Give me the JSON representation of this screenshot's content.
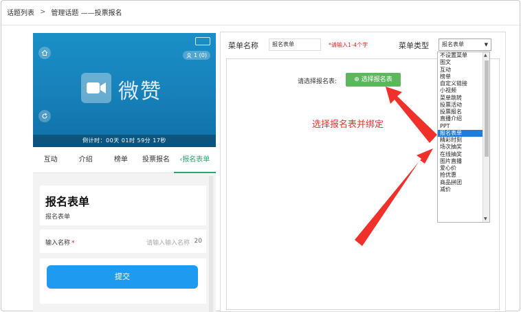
{
  "breadcrumb": {
    "root": "话题列表",
    "sep": ">",
    "current": "管理话题",
    "suffix": "——投票报名"
  },
  "phone": {
    "tag": "",
    "counter": "1 (0)",
    "logo_text": "微赞",
    "countdown": "倒计时：00天 01时 59分 17秒",
    "tabs": [
      {
        "label": "互动"
      },
      {
        "label": "介绍"
      },
      {
        "label": "榜单"
      },
      {
        "label": "投票报名"
      },
      {
        "label": "报名表单"
      }
    ],
    "form_title": "报名表单",
    "form_subtitle": "报名表单",
    "field_label": "输入名称",
    "field_required": "*",
    "field_placeholder": "请输入输入名称",
    "field_counter": "20",
    "submit_label": "提交"
  },
  "panel": {
    "menu_name_label": "菜单名称",
    "menu_name_value": "报名表单",
    "menu_name_hint": "*请输入1-4个字",
    "menu_type_label": "菜单类型",
    "menu_type_value": "报名表单",
    "choose_label": "请选择报名表:",
    "choose_button": "选择报名表",
    "annotation": "选择报名表并绑定"
  },
  "dropdown": {
    "options": [
      "不设置菜单",
      "图文",
      "互动",
      "榜单",
      "自定义链接",
      "小视频",
      "菜单跳转",
      "投票活动",
      "投票报名",
      "直播介绍",
      "PPT",
      "报名表单",
      "精彩时刻",
      "场次抽奖",
      "在线抽奖",
      "图片直播",
      "爱心价",
      "抢优惠",
      "商品拼团",
      "减价"
    ],
    "selected_index": 11
  },
  "colors": {
    "accent_green": "#2aa66b",
    "button_green": "#5cb85c",
    "submit_blue": "#1e9af0",
    "banner_blue": "#1a8fc7",
    "annotation_red": "#e8332e",
    "select_blue": "#1e7de0"
  }
}
